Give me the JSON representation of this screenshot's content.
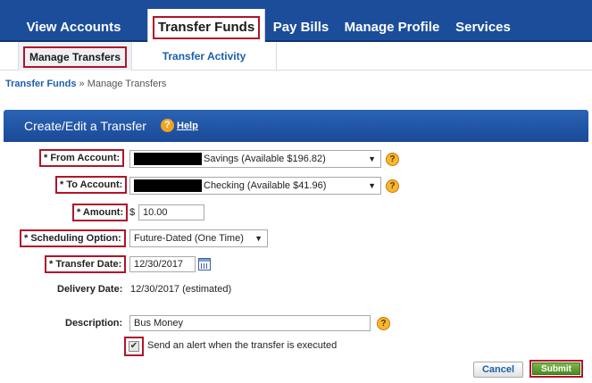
{
  "nav": {
    "tabs": [
      {
        "label": "View Accounts"
      },
      {
        "label": "Transfer Funds"
      },
      {
        "label": "Pay Bills"
      },
      {
        "label": "Manage Profile"
      },
      {
        "label": "Services"
      }
    ]
  },
  "subnav": {
    "tabs": [
      {
        "label": "Manage Transfers"
      },
      {
        "label": "Transfer Activity"
      }
    ]
  },
  "breadcrumb": {
    "parent": "Transfer Funds",
    "separator": " » ",
    "current": "Manage Transfers"
  },
  "panel": {
    "title": "Create/Edit a Transfer",
    "help_icon": "?",
    "help_label": "Help"
  },
  "form": {
    "from_label": "* From Account:",
    "from_value": "Savings (Available $196.82)",
    "to_label": "* To Account:",
    "to_value": "Checking (Available $41.96)",
    "amount_label": "* Amount:",
    "currency": "$",
    "amount_value": "10.00",
    "schedule_label": "* Scheduling Option:",
    "schedule_value": "Future-Dated (One Time)",
    "date_label": "* Transfer Date:",
    "date_value": "12/30/2017",
    "delivery_label": "Delivery Date:",
    "delivery_value": "12/30/2017 (estimated)",
    "description_label": "Description:",
    "description_value": "Bus Money",
    "alert_label": "Send an alert when the transfer is executed",
    "alert_checked": "✔"
  },
  "actions": {
    "cancel": "Cancel",
    "submit": "Submit"
  },
  "colors": {
    "nav_bg": "#1b4d9a",
    "highlight": "#b0142a",
    "link": "#1b5fae",
    "submit": "#5a9a2e"
  },
  "icons": {
    "help": "question-circle-icon",
    "dropdown": "chevron-down-icon",
    "calendar": "calendar-icon",
    "check": "checkmark-icon"
  }
}
